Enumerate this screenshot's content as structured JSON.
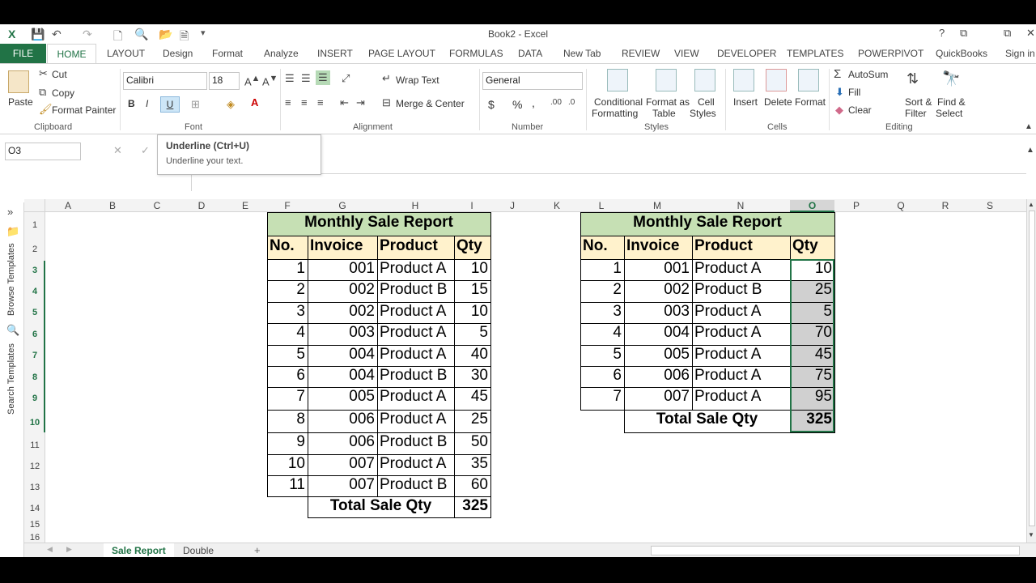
{
  "window": {
    "title": "Book2 - Excel",
    "help": "?",
    "restore": "⧉",
    "minimize": "🗕",
    "close": "✕"
  },
  "tabs": [
    "FILE",
    "HOME",
    "LAYOUT",
    "Design",
    "Format",
    "Analyze",
    "INSERT",
    "PAGE LAYOUT",
    "FORMULAS",
    "DATA",
    "New Tab",
    "REVIEW",
    "VIEW",
    "DEVELOPER",
    "TEMPLATES",
    "POWERPIVOT",
    "QuickBooks",
    "Sign in"
  ],
  "ribbon": {
    "paste": "Paste",
    "cut": "Cut",
    "copy": "Copy",
    "format_painter": "Format Painter",
    "clipboard": "Clipboard",
    "font_name": "Calibri",
    "font_size": "18",
    "bold": "B",
    "italic": "I",
    "underline": "U",
    "font_group": "Font",
    "wrap_text": "Wrap Text",
    "merge_center": "Merge & Center",
    "alignment": "Alignment",
    "number_format": "General",
    "dollar": "$",
    "percent": "%",
    "comma": ",",
    "number": "Number",
    "cond_format": "Conditional",
    "cond_format2": "Formatting",
    "format_table": "Format as",
    "format_table2": "Table",
    "cell_styles": "Cell",
    "cell_styles2": "Styles",
    "styles": "Styles",
    "insert": "Insert",
    "delete": "Delete",
    "format": "Format",
    "cells": "Cells",
    "autosum": "AutoSum",
    "fill": "Fill",
    "clear": "Clear",
    "sort_filter": "Sort &",
    "sort_filter2": "Filter",
    "find_select": "Find &",
    "find_select2": "Select",
    "editing": "Editing"
  },
  "name_box": "O3",
  "tooltip": {
    "title": "Underline (Ctrl+U)",
    "desc": "Underline your text."
  },
  "side_pane": {
    "browse": "Browse Templates",
    "search": "Search Templates"
  },
  "columns": [
    "A",
    "B",
    "C",
    "D",
    "E",
    "F",
    "G",
    "H",
    "I",
    "J",
    "K",
    "L",
    "M",
    "N",
    "O",
    "P",
    "Q",
    "R",
    "S"
  ],
  "rows": [
    "1",
    "2",
    "3",
    "4",
    "5",
    "6",
    "7",
    "8",
    "9",
    "10",
    "11",
    "12",
    "13",
    "14",
    "15",
    "16"
  ],
  "table1": {
    "title": "Monthly Sale Report",
    "headers": [
      "No.",
      "Invoice",
      "Product",
      "Qty"
    ],
    "rows": [
      [
        "1",
        "001",
        "Product A",
        "10"
      ],
      [
        "2",
        "002",
        "Product B",
        "15"
      ],
      [
        "3",
        "002",
        "Product A",
        "10"
      ],
      [
        "4",
        "003",
        "Product A",
        "5"
      ],
      [
        "5",
        "004",
        "Product A",
        "40"
      ],
      [
        "6",
        "004",
        "Product B",
        "30"
      ],
      [
        "7",
        "005",
        "Product A",
        "45"
      ],
      [
        "8",
        "006",
        "Product A",
        "25"
      ],
      [
        "9",
        "006",
        "Product B",
        "50"
      ],
      [
        "10",
        "007",
        "Product A",
        "35"
      ],
      [
        "11",
        "007",
        "Product B",
        "60"
      ]
    ],
    "total_label": "Total Sale Qty",
    "total": "325"
  },
  "table2": {
    "title": "Monthly Sale Report",
    "headers": [
      "No.",
      "Invoice",
      "Product",
      "Qty"
    ],
    "rows": [
      [
        "1",
        "001",
        "Product A",
        "10"
      ],
      [
        "2",
        "002",
        "Product B",
        "25"
      ],
      [
        "3",
        "003",
        "Product A",
        "5"
      ],
      [
        "4",
        "004",
        "Product A",
        "70"
      ],
      [
        "5",
        "005",
        "Product A",
        "45"
      ],
      [
        "6",
        "006",
        "Product A",
        "75"
      ],
      [
        "7",
        "007",
        "Product A",
        "95"
      ]
    ],
    "total_label": "Total Sale Qty",
    "total": "325"
  },
  "sheets": {
    "active": "Sale Report",
    "other": "Double",
    "add": "+"
  },
  "colors": {
    "accent": "#217346",
    "title_fill": "#c6e0b4",
    "header_fill": "#fff2cc",
    "selection": "#d0d0d0"
  }
}
